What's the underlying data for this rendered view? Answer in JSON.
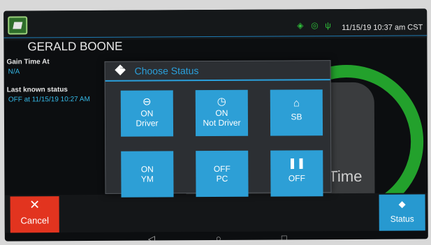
{
  "statusbar": {
    "datetime": "11/15/19 10:37 am CST",
    "icons": [
      "gps-icon",
      "signal-icon",
      "plug-icon"
    ]
  },
  "driver": {
    "name": "GERALD BOONE"
  },
  "info": {
    "gain_time_label": "Gain Time At",
    "gain_time_value": "N/A",
    "last_status_label": "Last known status",
    "last_status_value": "OFF at 11/15/19 10:27 AM"
  },
  "gauge": {
    "label": "Time"
  },
  "dialog": {
    "title": "Choose Status",
    "options": [
      {
        "icon": "steering-wheel-icon",
        "line1": "ON",
        "line2": "Driver"
      },
      {
        "icon": "clock-icon",
        "line1": "ON",
        "line2": "Not Driver"
      },
      {
        "icon": "sleeper-icon",
        "line1": "",
        "line2": "SB"
      },
      {
        "icon": "",
        "line1": "ON",
        "line2": "YM"
      },
      {
        "icon": "",
        "line1": "OFF",
        "line2": "PC"
      },
      {
        "icon": "pause-icon",
        "line1": "",
        "line2": "OFF"
      }
    ]
  },
  "buttons": {
    "cancel": "Cancel",
    "status": "Status"
  },
  "colors": {
    "accent": "#2d9fd6",
    "cancel": "#e2341f",
    "gauge": "#23a12c"
  }
}
